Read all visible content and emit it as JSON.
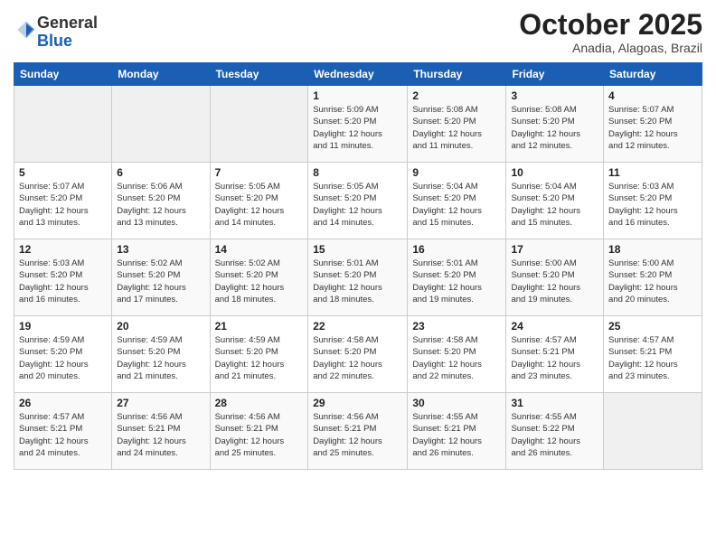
{
  "logo": {
    "general": "General",
    "blue": "Blue"
  },
  "title": "October 2025",
  "location": "Anadia, Alagoas, Brazil",
  "days_header": [
    "Sunday",
    "Monday",
    "Tuesday",
    "Wednesday",
    "Thursday",
    "Friday",
    "Saturday"
  ],
  "weeks": [
    [
      {
        "day": "",
        "info": ""
      },
      {
        "day": "",
        "info": ""
      },
      {
        "day": "",
        "info": ""
      },
      {
        "day": "1",
        "info": "Sunrise: 5:09 AM\nSunset: 5:20 PM\nDaylight: 12 hours\nand 11 minutes."
      },
      {
        "day": "2",
        "info": "Sunrise: 5:08 AM\nSunset: 5:20 PM\nDaylight: 12 hours\nand 11 minutes."
      },
      {
        "day": "3",
        "info": "Sunrise: 5:08 AM\nSunset: 5:20 PM\nDaylight: 12 hours\nand 12 minutes."
      },
      {
        "day": "4",
        "info": "Sunrise: 5:07 AM\nSunset: 5:20 PM\nDaylight: 12 hours\nand 12 minutes."
      }
    ],
    [
      {
        "day": "5",
        "info": "Sunrise: 5:07 AM\nSunset: 5:20 PM\nDaylight: 12 hours\nand 13 minutes."
      },
      {
        "day": "6",
        "info": "Sunrise: 5:06 AM\nSunset: 5:20 PM\nDaylight: 12 hours\nand 13 minutes."
      },
      {
        "day": "7",
        "info": "Sunrise: 5:05 AM\nSunset: 5:20 PM\nDaylight: 12 hours\nand 14 minutes."
      },
      {
        "day": "8",
        "info": "Sunrise: 5:05 AM\nSunset: 5:20 PM\nDaylight: 12 hours\nand 14 minutes."
      },
      {
        "day": "9",
        "info": "Sunrise: 5:04 AM\nSunset: 5:20 PM\nDaylight: 12 hours\nand 15 minutes."
      },
      {
        "day": "10",
        "info": "Sunrise: 5:04 AM\nSunset: 5:20 PM\nDaylight: 12 hours\nand 15 minutes."
      },
      {
        "day": "11",
        "info": "Sunrise: 5:03 AM\nSunset: 5:20 PM\nDaylight: 12 hours\nand 16 minutes."
      }
    ],
    [
      {
        "day": "12",
        "info": "Sunrise: 5:03 AM\nSunset: 5:20 PM\nDaylight: 12 hours\nand 16 minutes."
      },
      {
        "day": "13",
        "info": "Sunrise: 5:02 AM\nSunset: 5:20 PM\nDaylight: 12 hours\nand 17 minutes."
      },
      {
        "day": "14",
        "info": "Sunrise: 5:02 AM\nSunset: 5:20 PM\nDaylight: 12 hours\nand 18 minutes."
      },
      {
        "day": "15",
        "info": "Sunrise: 5:01 AM\nSunset: 5:20 PM\nDaylight: 12 hours\nand 18 minutes."
      },
      {
        "day": "16",
        "info": "Sunrise: 5:01 AM\nSunset: 5:20 PM\nDaylight: 12 hours\nand 19 minutes."
      },
      {
        "day": "17",
        "info": "Sunrise: 5:00 AM\nSunset: 5:20 PM\nDaylight: 12 hours\nand 19 minutes."
      },
      {
        "day": "18",
        "info": "Sunrise: 5:00 AM\nSunset: 5:20 PM\nDaylight: 12 hours\nand 20 minutes."
      }
    ],
    [
      {
        "day": "19",
        "info": "Sunrise: 4:59 AM\nSunset: 5:20 PM\nDaylight: 12 hours\nand 20 minutes."
      },
      {
        "day": "20",
        "info": "Sunrise: 4:59 AM\nSunset: 5:20 PM\nDaylight: 12 hours\nand 21 minutes."
      },
      {
        "day": "21",
        "info": "Sunrise: 4:59 AM\nSunset: 5:20 PM\nDaylight: 12 hours\nand 21 minutes."
      },
      {
        "day": "22",
        "info": "Sunrise: 4:58 AM\nSunset: 5:20 PM\nDaylight: 12 hours\nand 22 minutes."
      },
      {
        "day": "23",
        "info": "Sunrise: 4:58 AM\nSunset: 5:20 PM\nDaylight: 12 hours\nand 22 minutes."
      },
      {
        "day": "24",
        "info": "Sunrise: 4:57 AM\nSunset: 5:21 PM\nDaylight: 12 hours\nand 23 minutes."
      },
      {
        "day": "25",
        "info": "Sunrise: 4:57 AM\nSunset: 5:21 PM\nDaylight: 12 hours\nand 23 minutes."
      }
    ],
    [
      {
        "day": "26",
        "info": "Sunrise: 4:57 AM\nSunset: 5:21 PM\nDaylight: 12 hours\nand 24 minutes."
      },
      {
        "day": "27",
        "info": "Sunrise: 4:56 AM\nSunset: 5:21 PM\nDaylight: 12 hours\nand 24 minutes."
      },
      {
        "day": "28",
        "info": "Sunrise: 4:56 AM\nSunset: 5:21 PM\nDaylight: 12 hours\nand 25 minutes."
      },
      {
        "day": "29",
        "info": "Sunrise: 4:56 AM\nSunset: 5:21 PM\nDaylight: 12 hours\nand 25 minutes."
      },
      {
        "day": "30",
        "info": "Sunrise: 4:55 AM\nSunset: 5:21 PM\nDaylight: 12 hours\nand 26 minutes."
      },
      {
        "day": "31",
        "info": "Sunrise: 4:55 AM\nSunset: 5:22 PM\nDaylight: 12 hours\nand 26 minutes."
      },
      {
        "day": "",
        "info": ""
      }
    ]
  ]
}
